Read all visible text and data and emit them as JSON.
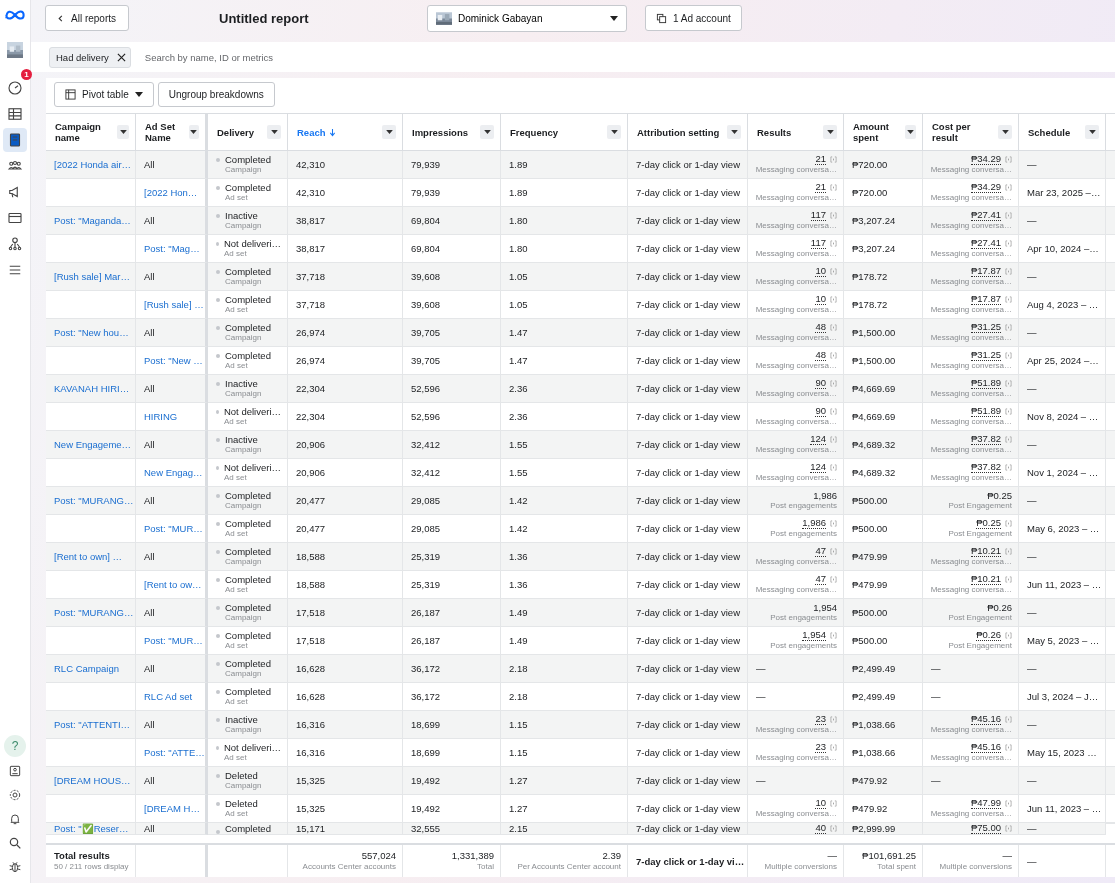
{
  "sidebar": {
    "items": [
      {
        "selected": false,
        "badge": "1"
      },
      {
        "selected": false
      },
      {
        "selected": true
      },
      {
        "selected": false
      },
      {
        "selected": false
      },
      {
        "selected": false
      },
      {
        "selected": false
      },
      {
        "selected": false
      }
    ],
    "help": "?"
  },
  "header": {
    "back": "All reports",
    "title": "Untitled report",
    "account": "Dominick Gabayan",
    "ad_accounts": "1 Ad account"
  },
  "filter": {
    "chip": "Had delivery",
    "placeholder": "Search by name, ID or metrics"
  },
  "toolbar": {
    "view": "Pivot table",
    "ungroup": "Ungroup breakdowns"
  },
  "columns": [
    {
      "label": "Campaign name",
      "sorted": false
    },
    {
      "label": "Ad Set Name",
      "sorted": false
    },
    {
      "label": "Delivery",
      "sorted": false
    },
    {
      "label": "Reach",
      "sorted": true
    },
    {
      "label": "Impressions",
      "sorted": false
    },
    {
      "label": "Frequency",
      "sorted": false
    },
    {
      "label": "Attribution setting",
      "sorted": false
    },
    {
      "label": "Results",
      "sorted": false
    },
    {
      "label": "Amount spent",
      "sorted": false
    },
    {
      "label": "Cost per result",
      "sorted": false
    },
    {
      "label": "Schedule",
      "sorted": false
    }
  ],
  "rows": [
    {
      "kind": "campaign",
      "name": "[2022 Honda air…",
      "all": "All",
      "del": "Completed",
      "dt": "Campaign",
      "reach": "42,310",
      "imp": "79,939",
      "freq": "1.89",
      "attr": "7-day click or 1-day view",
      "res": "21",
      "rs": "Messaging conversa…",
      "fn": true,
      "amt": "₱720.00",
      "cost": "₱34.29",
      "cs": "Messaging conversa…",
      "cfn": true,
      "sch": "—"
    },
    {
      "kind": "adset",
      "name": "[2022 Hon…",
      "del": "Completed",
      "dt": "Ad set",
      "reach": "42,310",
      "imp": "79,939",
      "freq": "1.89",
      "attr": "7-day click or 1-day view",
      "res": "21",
      "rs": "Messaging conversa…",
      "fn": true,
      "amt": "₱720.00",
      "cost": "₱34.29",
      "cs": "Messaging conversa…",
      "cfn": true,
      "sch": "Mar 23, 2025 –…"
    },
    {
      "kind": "campaign",
      "name": "Post: \"Maganda…",
      "all": "All",
      "del": "Inactive",
      "dt": "Campaign",
      "reach": "38,817",
      "imp": "69,804",
      "freq": "1.80",
      "attr": "7-day click or 1-day view",
      "res": "117",
      "rs": "Messaging conversa…",
      "fn": true,
      "amt": "₱3,207.24",
      "cost": "₱27.41",
      "cs": "Messaging conversa…",
      "cfn": true,
      "sch": "—"
    },
    {
      "kind": "adset",
      "name": "Post: \"Mag…",
      "del": "Not deliveri…",
      "dt": "Ad set",
      "reach": "38,817",
      "imp": "69,804",
      "freq": "1.80",
      "attr": "7-day click or 1-day view",
      "res": "117",
      "rs": "Messaging conversa…",
      "fn": true,
      "amt": "₱3,207.24",
      "cost": "₱27.41",
      "cs": "Messaging conversa…",
      "cfn": true,
      "sch": "Apr 10, 2024 –…"
    },
    {
      "kind": "campaign",
      "name": "[Rush sale] Mar…",
      "all": "All",
      "del": "Completed",
      "dt": "Campaign",
      "reach": "37,718",
      "imp": "39,608",
      "freq": "1.05",
      "attr": "7-day click or 1-day view",
      "res": "10",
      "rs": "Messaging conversa…",
      "fn": true,
      "amt": "₱178.72",
      "cost": "₱17.87",
      "cs": "Messaging conversa…",
      "cfn": true,
      "sch": "—"
    },
    {
      "kind": "adset",
      "name": "[Rush sale] …",
      "del": "Completed",
      "dt": "Ad set",
      "reach": "37,718",
      "imp": "39,608",
      "freq": "1.05",
      "attr": "7-day click or 1-day view",
      "res": "10",
      "rs": "Messaging conversa…",
      "fn": true,
      "amt": "₱178.72",
      "cost": "₱17.87",
      "cs": "Messaging conversa…",
      "cfn": true,
      "sch": "Aug 4, 2023 – …"
    },
    {
      "kind": "campaign",
      "name": "Post: \"New hou…",
      "all": "All",
      "del": "Completed",
      "dt": "Campaign",
      "reach": "26,974",
      "imp": "39,705",
      "freq": "1.47",
      "attr": "7-day click or 1-day view",
      "res": "48",
      "rs": "Messaging conversa…",
      "fn": true,
      "amt": "₱1,500.00",
      "cost": "₱31.25",
      "cs": "Messaging conversa…",
      "cfn": true,
      "sch": "—"
    },
    {
      "kind": "adset",
      "name": "Post: \"New …",
      "del": "Completed",
      "dt": "Ad set",
      "reach": "26,974",
      "imp": "39,705",
      "freq": "1.47",
      "attr": "7-day click or 1-day view",
      "res": "48",
      "rs": "Messaging conversa…",
      "fn": true,
      "amt": "₱1,500.00",
      "cost": "₱31.25",
      "cs": "Messaging conversa…",
      "cfn": true,
      "sch": "Apr 25, 2024 –…"
    },
    {
      "kind": "campaign",
      "name": "KAVANAH HIRI…",
      "all": "All",
      "del": "Inactive",
      "dt": "Campaign",
      "reach": "22,304",
      "imp": "52,596",
      "freq": "2.36",
      "attr": "7-day click or 1-day view",
      "res": "90",
      "rs": "Messaging conversa…",
      "fn": true,
      "amt": "₱4,669.69",
      "cost": "₱51.89",
      "cs": "Messaging conversa…",
      "cfn": true,
      "sch": "—"
    },
    {
      "kind": "adset",
      "name": "HIRING",
      "del": "Not deliveri…",
      "dt": "Ad set",
      "reach": "22,304",
      "imp": "52,596",
      "freq": "2.36",
      "attr": "7-day click or 1-day view",
      "res": "90",
      "rs": "Messaging conversa…",
      "fn": true,
      "amt": "₱4,669.69",
      "cost": "₱51.89",
      "cs": "Messaging conversa…",
      "cfn": true,
      "sch": "Nov 8, 2024 – …"
    },
    {
      "kind": "campaign",
      "name": "New Engageme…",
      "all": "All",
      "del": "Inactive",
      "dt": "Campaign",
      "reach": "20,906",
      "imp": "32,412",
      "freq": "1.55",
      "attr": "7-day click or 1-day view",
      "res": "124",
      "rs": "Messaging conversa…",
      "fn": true,
      "amt": "₱4,689.32",
      "cost": "₱37.82",
      "cs": "Messaging conversa…",
      "cfn": true,
      "sch": "—"
    },
    {
      "kind": "adset",
      "name": "New Engag…",
      "del": "Not deliveri…",
      "dt": "Ad set",
      "reach": "20,906",
      "imp": "32,412",
      "freq": "1.55",
      "attr": "7-day click or 1-day view",
      "res": "124",
      "rs": "Messaging conversa…",
      "fn": true,
      "amt": "₱4,689.32",
      "cost": "₱37.82",
      "cs": "Messaging conversa…",
      "cfn": true,
      "sch": "Nov 1, 2024 – …"
    },
    {
      "kind": "campaign",
      "name": "Post: \"MURANG…",
      "all": "All",
      "del": "Completed",
      "dt": "Campaign",
      "reach": "20,477",
      "imp": "29,085",
      "freq": "1.42",
      "attr": "7-day click or 1-day view",
      "res": "1,986",
      "rs": "Post engagements",
      "fn": false,
      "amt": "₱500.00",
      "cost": "₱0.25",
      "cs": "Post Engagement",
      "cfn": false,
      "sch": "—"
    },
    {
      "kind": "adset",
      "name": "Post: \"MUR…",
      "del": "Completed",
      "dt": "Ad set",
      "reach": "20,477",
      "imp": "29,085",
      "freq": "1.42",
      "attr": "7-day click or 1-day view",
      "res": "1,986",
      "rs": "Post engagements",
      "fn": true,
      "amt": "₱500.00",
      "cost": "₱0.25",
      "cs": "Post Engagement",
      "cfn": true,
      "sch": "May 6, 2023 – …"
    },
    {
      "kind": "campaign",
      "name": "[Rent to own] …",
      "all": "All",
      "del": "Completed",
      "dt": "Campaign",
      "reach": "18,588",
      "imp": "25,319",
      "freq": "1.36",
      "attr": "7-day click or 1-day view",
      "res": "47",
      "rs": "Messaging conversa…",
      "fn": true,
      "amt": "₱479.99",
      "cost": "₱10.21",
      "cs": "Messaging conversa…",
      "cfn": true,
      "sch": "—"
    },
    {
      "kind": "adset",
      "name": "[Rent to ow…",
      "del": "Completed",
      "dt": "Ad set",
      "reach": "18,588",
      "imp": "25,319",
      "freq": "1.36",
      "attr": "7-day click or 1-day view",
      "res": "47",
      "rs": "Messaging conversa…",
      "fn": true,
      "amt": "₱479.99",
      "cost": "₱10.21",
      "cs": "Messaging conversa…",
      "cfn": true,
      "sch": "Jun 11, 2023 – …"
    },
    {
      "kind": "campaign",
      "name": "Post: \"MURANG…",
      "all": "All",
      "del": "Completed",
      "dt": "Campaign",
      "reach": "17,518",
      "imp": "26,187",
      "freq": "1.49",
      "attr": "7-day click or 1-day view",
      "res": "1,954",
      "rs": "Post engagements",
      "fn": false,
      "amt": "₱500.00",
      "cost": "₱0.26",
      "cs": "Post Engagement",
      "cfn": false,
      "sch": "—"
    },
    {
      "kind": "adset",
      "name": "Post: \"MUR…",
      "del": "Completed",
      "dt": "Ad set",
      "reach": "17,518",
      "imp": "26,187",
      "freq": "1.49",
      "attr": "7-day click or 1-day view",
      "res": "1,954",
      "rs": "Post engagements",
      "fn": true,
      "amt": "₱500.00",
      "cost": "₱0.26",
      "cs": "Post Engagement",
      "cfn": true,
      "sch": "May 5, 2023 – …"
    },
    {
      "kind": "campaign",
      "name": "RLC Campaign",
      "all": "All",
      "del": "Completed",
      "dt": "Campaign",
      "reach": "16,628",
      "imp": "36,172",
      "freq": "2.18",
      "attr": "7-day click or 1-day view",
      "res": "—",
      "fn": false,
      "amt": "₱2,499.49",
      "cost": "—",
      "cfn": false,
      "sch": "—"
    },
    {
      "kind": "adset",
      "name": "RLC Ad set",
      "del": "Completed",
      "dt": "Ad set",
      "reach": "16,628",
      "imp": "36,172",
      "freq": "2.18",
      "attr": "7-day click or 1-day view",
      "res": "—",
      "fn": false,
      "amt": "₱2,499.49",
      "cost": "—",
      "cfn": false,
      "sch": "Jul 3, 2024 – J…"
    },
    {
      "kind": "campaign",
      "name": "Post: \"ATTENTI…",
      "all": "All",
      "del": "Inactive",
      "dt": "Campaign",
      "reach": "16,316",
      "imp": "18,699",
      "freq": "1.15",
      "attr": "7-day click or 1-day view",
      "res": "23",
      "rs": "Messaging conversa…",
      "fn": true,
      "amt": "₱1,038.66",
      "cost": "₱45.16",
      "cs": "Messaging conversa…",
      "cfn": true,
      "sch": "—"
    },
    {
      "kind": "adset",
      "name": "Post: \"ATTE…",
      "del": "Not deliveri…",
      "dt": "Ad set",
      "reach": "16,316",
      "imp": "18,699",
      "freq": "1.15",
      "attr": "7-day click or 1-day view",
      "res": "23",
      "rs": "Messaging conversa…",
      "fn": true,
      "amt": "₱1,038.66",
      "cost": "₱45.16",
      "cs": "Messaging conversa…",
      "cfn": true,
      "sch": "May 15, 2023 …"
    },
    {
      "kind": "campaign",
      "name": "[DREAM HOUS…",
      "all": "All",
      "del": "Deleted",
      "dt": "Campaign",
      "reach": "15,325",
      "imp": "19,492",
      "freq": "1.27",
      "attr": "7-day click or 1-day view",
      "res": "—",
      "fn": false,
      "amt": "₱479.92",
      "cost": "—",
      "cfn": false,
      "sch": "—"
    },
    {
      "kind": "adset",
      "name": "[DREAM H…",
      "del": "Deleted",
      "dt": "Ad set",
      "reach": "15,325",
      "imp": "19,492",
      "freq": "1.27",
      "attr": "7-day click or 1-day view",
      "res": "10",
      "rs": "Messaging conversa…",
      "fn": true,
      "amt": "₱479.92",
      "cost": "₱47.99",
      "cs": "Messaging conversa…",
      "cfn": true,
      "sch": "Jun 11, 2023 – …"
    },
    {
      "kind": "campaign",
      "name": "Post: \"✅Reser…",
      "all": "All",
      "del": "Completed",
      "reach": "15,171",
      "imp": "32,555",
      "freq": "2.15",
      "attr": "7-day click or 1-day view",
      "res": "40",
      "fn": true,
      "amt": "₱2,999.99",
      "cost": "₱75.00",
      "cfn": true,
      "sch": "—"
    }
  ],
  "totals": {
    "label": "Total results",
    "rows": "50 / 211 rows display",
    "reach": "557,024",
    "reach_sub": "Accounts Center accounts",
    "imp": "1,331,389",
    "imp_sub": "Total",
    "freq": "2.39",
    "freq_sub": "Per Accounts Center account",
    "attr": "7-day click or 1-day vi…",
    "res": "—",
    "res_sub": "Multiple conversions",
    "amt": "₱101,691.25",
    "amt_sub": "Total spent",
    "cost": "—",
    "cost_sub": "Multiple conversions",
    "sch": "—"
  }
}
